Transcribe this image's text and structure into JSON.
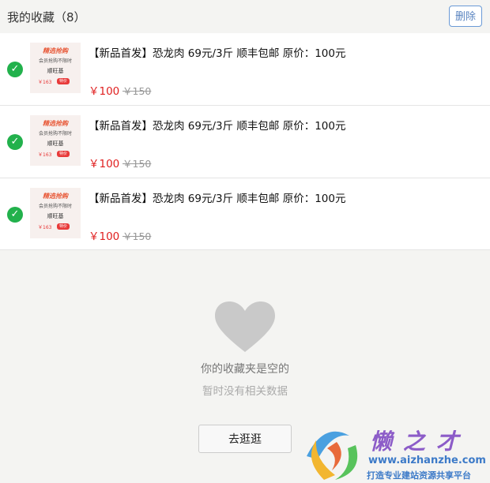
{
  "header": {
    "title": "我的收藏（8）",
    "delete_label": "删除"
  },
  "items": [
    {
      "name": "【新品首发】恐龙肉 69元/3斤 顺丰包邮 原价：100元",
      "price": "￥100",
      "original_price": "￥150",
      "thumb": {
        "banner": "精选抢购",
        "sub": "会员抢购不限时",
        "brand": "顺旺基",
        "price": "￥163",
        "tag": "特价"
      }
    },
    {
      "name": "【新品首发】恐龙肉 69元/3斤 顺丰包邮 原价：100元",
      "price": "￥100",
      "original_price": "￥150",
      "thumb": {
        "banner": "精选抢购",
        "sub": "会员抢购不限时",
        "brand": "顺旺基",
        "price": "￥163",
        "tag": "特价"
      }
    },
    {
      "name": "【新品首发】恐龙肉 69元/3斤 顺丰包邮 原价：100元",
      "price": "￥100",
      "original_price": "￥150",
      "thumb": {
        "banner": "精选抢购",
        "sub": "会员抢购不限时",
        "brand": "顺旺基",
        "price": "￥163",
        "tag": "特价"
      }
    }
  ],
  "empty_state": {
    "message": "你的收藏夹是空的",
    "sub_message": "暂时没有相关数据",
    "button_label": "去逛逛",
    "icon": "heart-icon"
  },
  "watermark": {
    "title": "懒之才",
    "url": "www.aizhanzhe.com",
    "slogan": "打造专业建站资源共享平台"
  },
  "colors": {
    "accent_price": "#e02020",
    "check_green": "#22b14c",
    "delete_border": "#6a9ad6"
  }
}
